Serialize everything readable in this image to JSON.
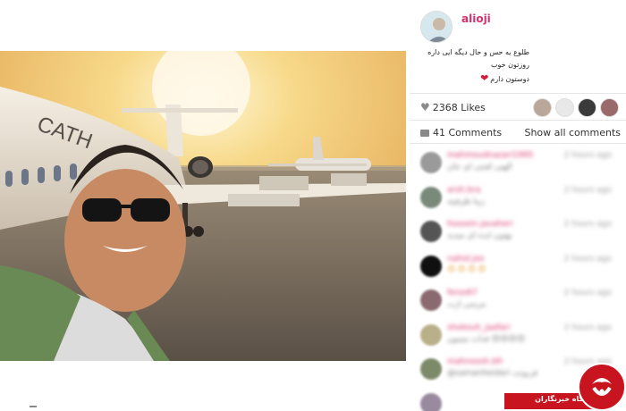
{
  "post": {
    "username": "alioji",
    "caption_lines": [
      "طلوع یه حس و حال دیگه ایی داره",
      "روزتون خوب",
      "دوستون دارم"
    ],
    "likes_label": "2368 Likes",
    "comments_label": "41 Comments",
    "show_all_label": "Show all comments"
  },
  "comments": [
    {
      "user": "mahmoudnazari1995",
      "text": "الهیی لعنتی ای جان",
      "time": "2 hours ago",
      "avatar_color": "#9a9a9a"
    },
    {
      "user": "arsh.bra",
      "text": "زیبا ظرفیته",
      "time": "2 hours ago",
      "avatar_color": "#7a8a7a"
    },
    {
      "user": "hossein.javaheri",
      "text": "بهتون ایده ای میدید",
      "time": "2 hours ago",
      "avatar_color": "#555555"
    },
    {
      "user": "nahid.joo",
      "text": "😍😍😍😍",
      "time": "2 hours ago",
      "avatar_color": "#101010",
      "emoji": true
    },
    {
      "user": "feroz67",
      "text": "مرسی ازت",
      "time": "2 hours ago",
      "avatar_color": "#8a6a70"
    },
    {
      "user": "shokouh_jaafari",
      "text": "فدات ممنون 😍😍😍😍",
      "time": "2 hours ago",
      "avatar_color": "#b9b08a"
    },
    {
      "user": "mahnoosh.bfr",
      "text": "@samanheidari قربونت",
      "time": "2 hours ago",
      "avatar_color": "#7d8a6a"
    },
    {
      "user": "",
      "text": "",
      "time": "",
      "avatar_color": "#9a8aa0"
    }
  ],
  "logo": {
    "text": "باشگاه خبرنگاران"
  },
  "colors": {
    "username": "#d8306a",
    "heart": "#d21e3a",
    "logo_red": "#c8141e"
  }
}
